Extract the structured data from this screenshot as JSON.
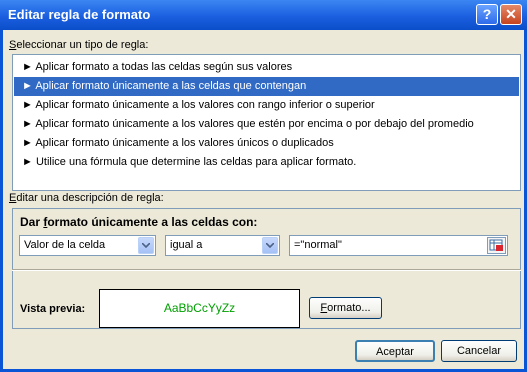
{
  "window": {
    "title": "Editar regla de formato",
    "help_icon": "?",
    "close_icon": "✕"
  },
  "rule_type": {
    "label_prefix": "",
    "label_access": "S",
    "label_rest": "eleccionar un tipo de regla:",
    "items": [
      "► Aplicar formato a todas las celdas según sus valores",
      "► Aplicar formato únicamente a las celdas que contengan",
      "► Aplicar formato únicamente a los valores con rango inferior o superior",
      "► Aplicar formato únicamente a los valores que estén por encima o por debajo del promedio",
      "► Aplicar formato únicamente a los valores únicos o duplicados",
      "► Utilice una fórmula que determine las celdas para aplicar formato."
    ],
    "selected_index": 1
  },
  "description": {
    "label_prefix": "",
    "label_access": "E",
    "label_rest": "ditar una descripción de regla:",
    "heading_prefix": "Dar ",
    "heading_access": "f",
    "heading_rest": "ormato únicamente a las celdas con:",
    "condition_type": "Valor de la celda",
    "operator": "igual a",
    "value": "=\"normal\""
  },
  "preview": {
    "label": "Vista previa:",
    "sample": "AaBbCcYyZz",
    "sample_color": "#00a000"
  },
  "buttons": {
    "format_access": "F",
    "format_rest": "ormato...",
    "accept": "Aceptar",
    "cancel": "Cancelar"
  }
}
